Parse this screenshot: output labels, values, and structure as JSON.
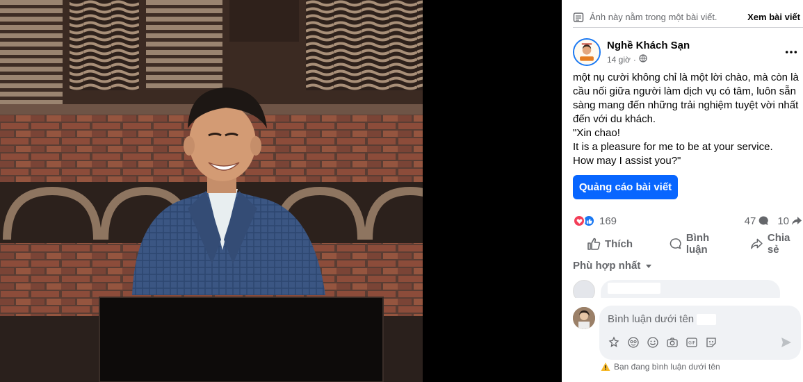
{
  "notice": {
    "text": "Ảnh này nằm trong một bài viết.",
    "see_post_label": "Xem bài viết"
  },
  "post": {
    "page_name": "Nghề Khách Sạn",
    "time": "14 giờ",
    "privacy_icon": "globe-icon",
    "body_lines": [
      "một nụ cười không chỉ là một lời chào, mà còn là cầu nối giữa người làm dịch vụ có tâm, luôn sẵn sàng mang đến những trải nghiệm tuyệt vời nhất đến với du khách.",
      "\"Xin chao!",
      "It is a pleasure for me to be at your service.",
      "How may I assist you?\""
    ],
    "promote_label": "Quảng cáo bài viết"
  },
  "stats": {
    "reactions_count": "169",
    "comments_count": "47",
    "shares_count": "10"
  },
  "actions": {
    "like_label": "Thích",
    "comment_label": "Bình luận",
    "share_label": "Chia sẻ"
  },
  "comments": {
    "filter_label": "Phù hợp nhất"
  },
  "composer": {
    "placeholder": "Bình luận dưới tên",
    "warning": "Bạn đang bình luận dưới tên"
  },
  "colors": {
    "accent": "#0866ff",
    "love": "#f33e58",
    "like": "#1877f2",
    "secondary_text": "#65676b",
    "warning": "#f7b928"
  }
}
